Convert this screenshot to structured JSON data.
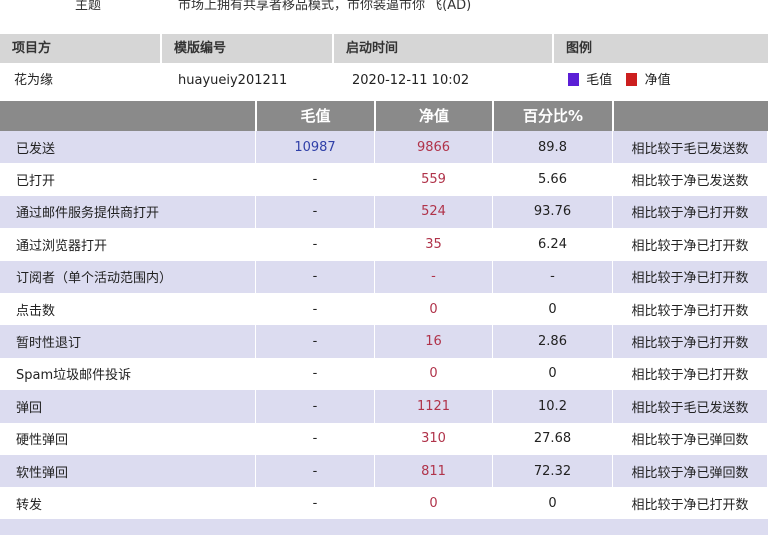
{
  "top": {
    "label": "主题",
    "value": "市场上拥有共享者移品模式，市你装逼市你 飞(AD)"
  },
  "header": {
    "col1": "项目方",
    "col2": "模版编号",
    "col3": "启动时间",
    "col4": "图例"
  },
  "info": {
    "project": "花为缘",
    "template_id": "huayueiy201211",
    "start_time": "2020-12-11 10:02",
    "legend": [
      {
        "label": "毛值",
        "color": "#5b1fd6"
      },
      {
        "label": "净值",
        "color": "#cc1f1f"
      }
    ]
  },
  "table": {
    "headers": [
      "毛值",
      "净值",
      "百分比%"
    ],
    "rows": [
      {
        "name": "已发送",
        "gross": "10987",
        "net": "9866",
        "pct": "89.8",
        "note": "相比较于毛已发送数"
      },
      {
        "name": "已打开",
        "gross": "-",
        "net": "559",
        "pct": "5.66",
        "note": "相比较于净已发送数"
      },
      {
        "name": "通过邮件服务提供商打开",
        "gross": "-",
        "net": "524",
        "pct": "93.76",
        "note": "相比较于净已打开数"
      },
      {
        "name": "通过浏览器打开",
        "gross": "-",
        "net": "35",
        "pct": "6.24",
        "note": "相比较于净已打开数"
      },
      {
        "name": "订阅者（单个活动范围内）",
        "gross": "-",
        "net": "-",
        "pct": "-",
        "note": "相比较于净已打开数"
      },
      {
        "name": "点击数",
        "gross": "-",
        "net": "0",
        "pct": "0",
        "note": "相比较于净已打开数"
      },
      {
        "name": "暂时性退订",
        "gross": "-",
        "net": "16",
        "pct": "2.86",
        "note": "相比较于净已打开数"
      },
      {
        "name": "Spam垃圾邮件投诉",
        "gross": "-",
        "net": "0",
        "pct": "0",
        "note": "相比较于净已打开数"
      },
      {
        "name": "弹回",
        "gross": "-",
        "net": "1121",
        "pct": "10.2",
        "note": "相比较于毛已发送数"
      },
      {
        "name": "硬性弹回",
        "gross": "-",
        "net": "310",
        "pct": "27.68",
        "note": "相比较于净已弹回数"
      },
      {
        "name": "软性弹回",
        "gross": "-",
        "net": "811",
        "pct": "72.32",
        "note": "相比较于净已弹回数"
      },
      {
        "name": "转发",
        "gross": "-",
        "net": "0",
        "pct": "0",
        "note": "相比较于净已打开数"
      }
    ]
  }
}
